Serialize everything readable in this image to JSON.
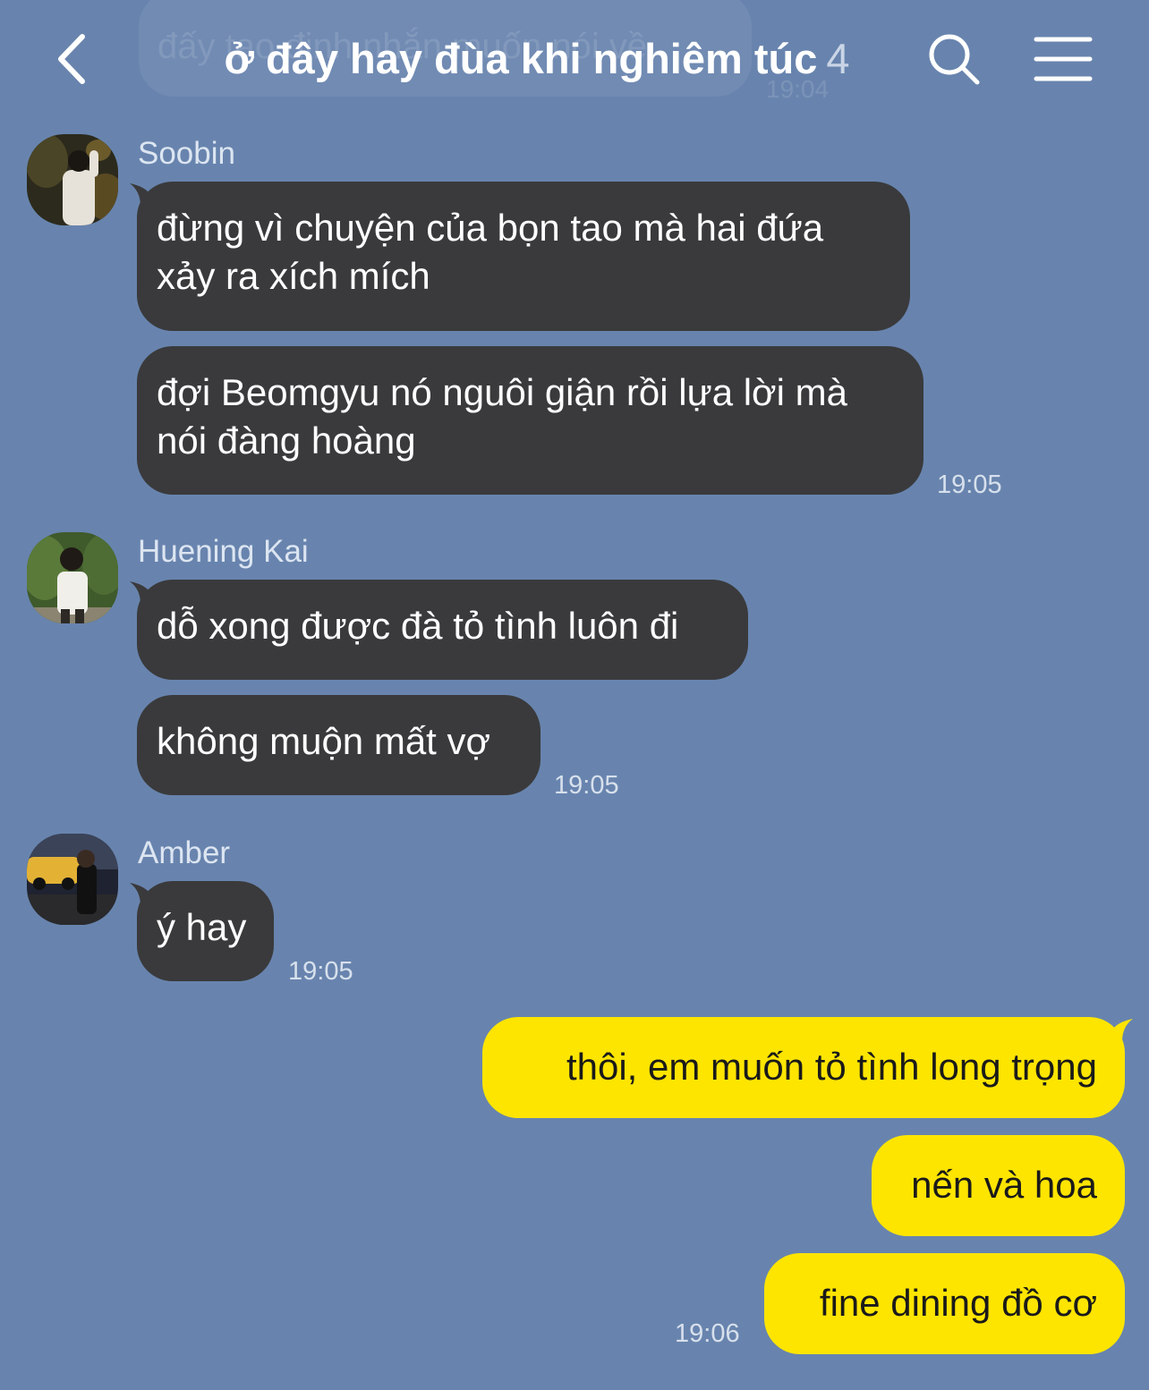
{
  "header": {
    "title": "ở đây hay đùa khi nghiêm túc",
    "member_count": "4",
    "scrolled_message": "đấy tao định nhắn muốn nói về",
    "scrolled_time": "19:04"
  },
  "messages": {
    "soobin": {
      "name": "Soobin",
      "msg1_line1": "đừng vì chuyện của bọn tao mà hai đứa",
      "msg1_line2": "xảy ra xích mích",
      "msg2_line1": "đợi Beomgyu nó nguôi giận rồi lựa lời mà",
      "msg2_line2": "nói đàng hoàng",
      "time": "19:05"
    },
    "huening": {
      "name": "Huening Kai",
      "msg1": "dỗ xong được đà tỏ tình luôn đi",
      "msg2": "không muộn mất vợ",
      "time": "19:05"
    },
    "amber": {
      "name": "Amber",
      "msg1": "ý hay",
      "time": "19:05"
    },
    "me": {
      "msg1": "thôi, em muốn tỏ tình long trọng",
      "msg2": "nến và hoa",
      "msg3": "fine dining đồ cơ",
      "time": "19:06"
    }
  },
  "colors": {
    "background": "#6884ae",
    "incoming_bubble": "#3a3a3c",
    "outgoing_bubble": "#fee500"
  },
  "icons": {
    "back": "chevron-left-icon",
    "search": "search-icon",
    "menu": "hamburger-menu-icon"
  }
}
